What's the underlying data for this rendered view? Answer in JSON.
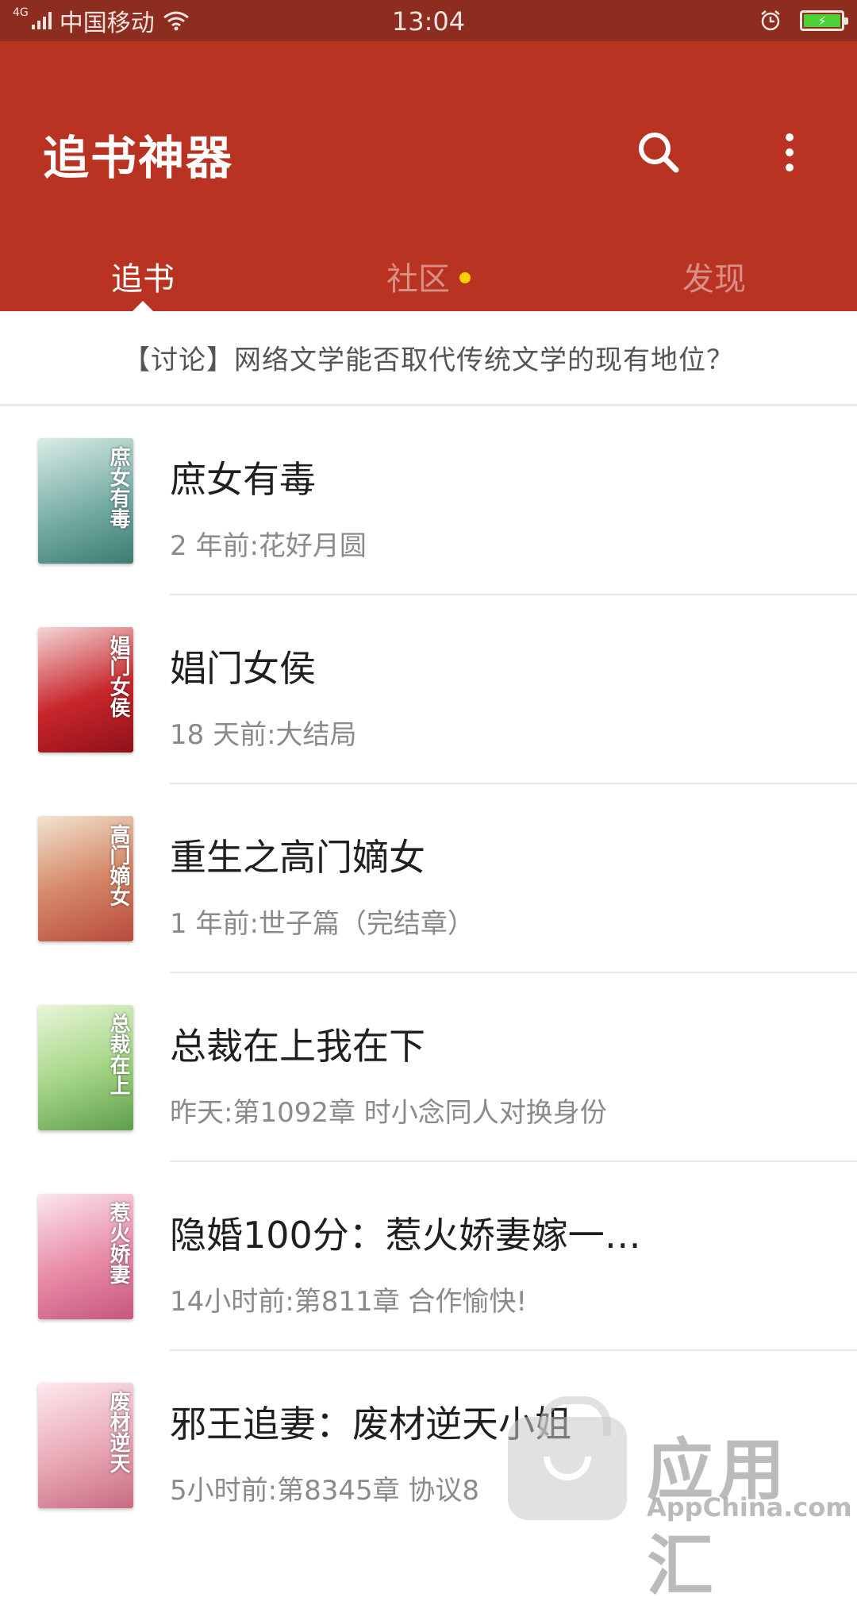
{
  "status_bar": {
    "network": "4G",
    "carrier": "中国移动",
    "time": "13:04",
    "icons": [
      "signal-icon",
      "wifi-icon",
      "alarm-icon",
      "battery-charging-icon"
    ]
  },
  "app_bar": {
    "title": "追书神器",
    "background": "#b93323",
    "actions": [
      "search-icon",
      "more-vertical-icon"
    ]
  },
  "tabs": [
    {
      "label": "追书",
      "active": true
    },
    {
      "label": "社区",
      "active": false,
      "has_dot": true
    },
    {
      "label": "发现",
      "active": false
    }
  ],
  "banner": {
    "text": "【讨论】网络文学能否取代传统文学的现有地位？"
  },
  "books": [
    {
      "title": "庶女有毒",
      "update": "2 年前:花好月圆",
      "cover_text": "庶女有毒",
      "cover_color": "#6fa8a0"
    },
    {
      "title": "娼门女侯",
      "update": "18 天前:大结局",
      "cover_text": "娼门女侯",
      "cover_color": "#c8262b"
    },
    {
      "title": "重生之高门嫡女",
      "update": "1 年前:世子篇（完结章）",
      "cover_text": "高门嫡女",
      "cover_color": "#b84a3c"
    },
    {
      "title": "总裁在上我在下",
      "update": "昨天:第1092章 时小念同人对换身份",
      "cover_text": "总裁在上",
      "cover_color": "#7fbf6a"
    },
    {
      "title": "隐婚100分：惹火娇妻嫁一…",
      "update": "14小时前:第811章 合作愉快!",
      "cover_text": "惹火娇妻",
      "cover_color": "#e88aa6"
    },
    {
      "title": "邪王追妻：废材逆天小姐",
      "update": "5小时前:第8345章 协议8",
      "cover_text": "废材逆天",
      "cover_color": "#e8a7b5"
    }
  ],
  "watermark": {
    "cn": "应用汇",
    "en": "AppChina.com"
  }
}
